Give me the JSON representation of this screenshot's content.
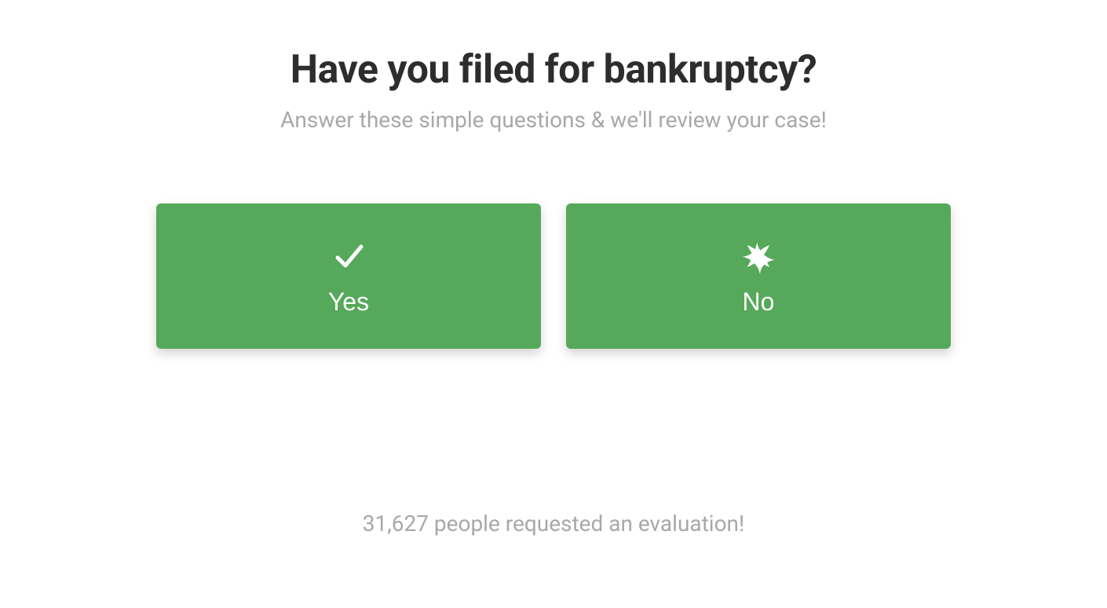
{
  "question": {
    "title": "Have you filed for bankruptcy?",
    "subtitle": "Answer these simple questions & we'll review your case!"
  },
  "options": {
    "yes": "Yes",
    "no": "No"
  },
  "footer": {
    "text": "31,627 people requested an evaluation!"
  },
  "colors": {
    "button_bg": "#56a85a",
    "title_text": "#2d2d2d",
    "muted_text": "#a8a8a8"
  }
}
